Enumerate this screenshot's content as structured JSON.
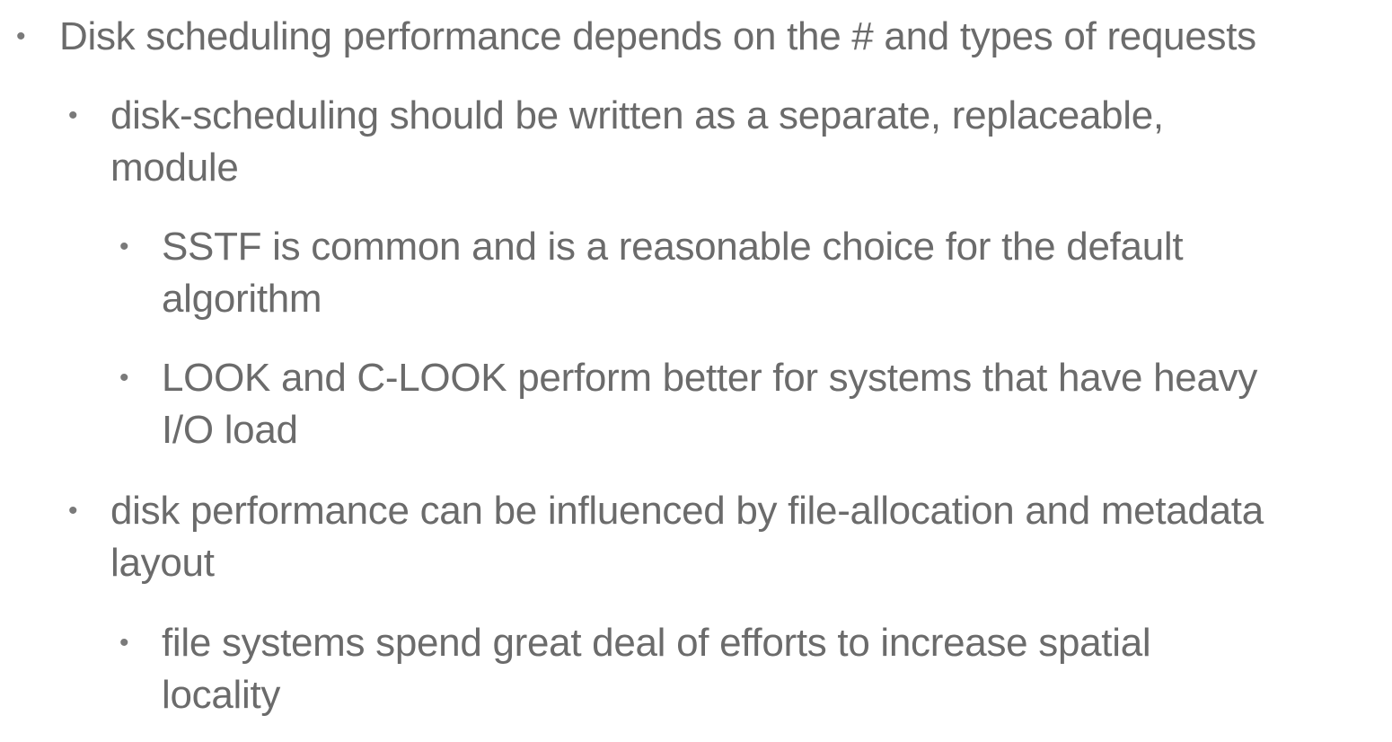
{
  "slide": {
    "bullets": [
      {
        "level": 1,
        "marker": "•",
        "lines": [
          "Disk scheduling performance depends on the # and types of requests"
        ]
      },
      {
        "level": 2,
        "marker": "•",
        "lines": [
          "disk-scheduling should be written as a separate, replaceable,",
          "module"
        ]
      },
      {
        "level": 3,
        "marker": "•",
        "lines": [
          "SSTF is common and is a reasonable choice for the default",
          "algorithm"
        ]
      },
      {
        "level": 3,
        "marker": "•",
        "lines": [
          "LOOK and C-LOOK perform better for systems that have heavy",
          "I/O load"
        ]
      },
      {
        "level": 2,
        "marker": "•",
        "lines": [
          "disk performance can be influenced by file-allocation and metadata",
          "layout"
        ]
      },
      {
        "level": 3,
        "marker": "•",
        "lines": [
          "file systems spend great deal of efforts to increase spatial",
          "locality"
        ]
      }
    ]
  }
}
